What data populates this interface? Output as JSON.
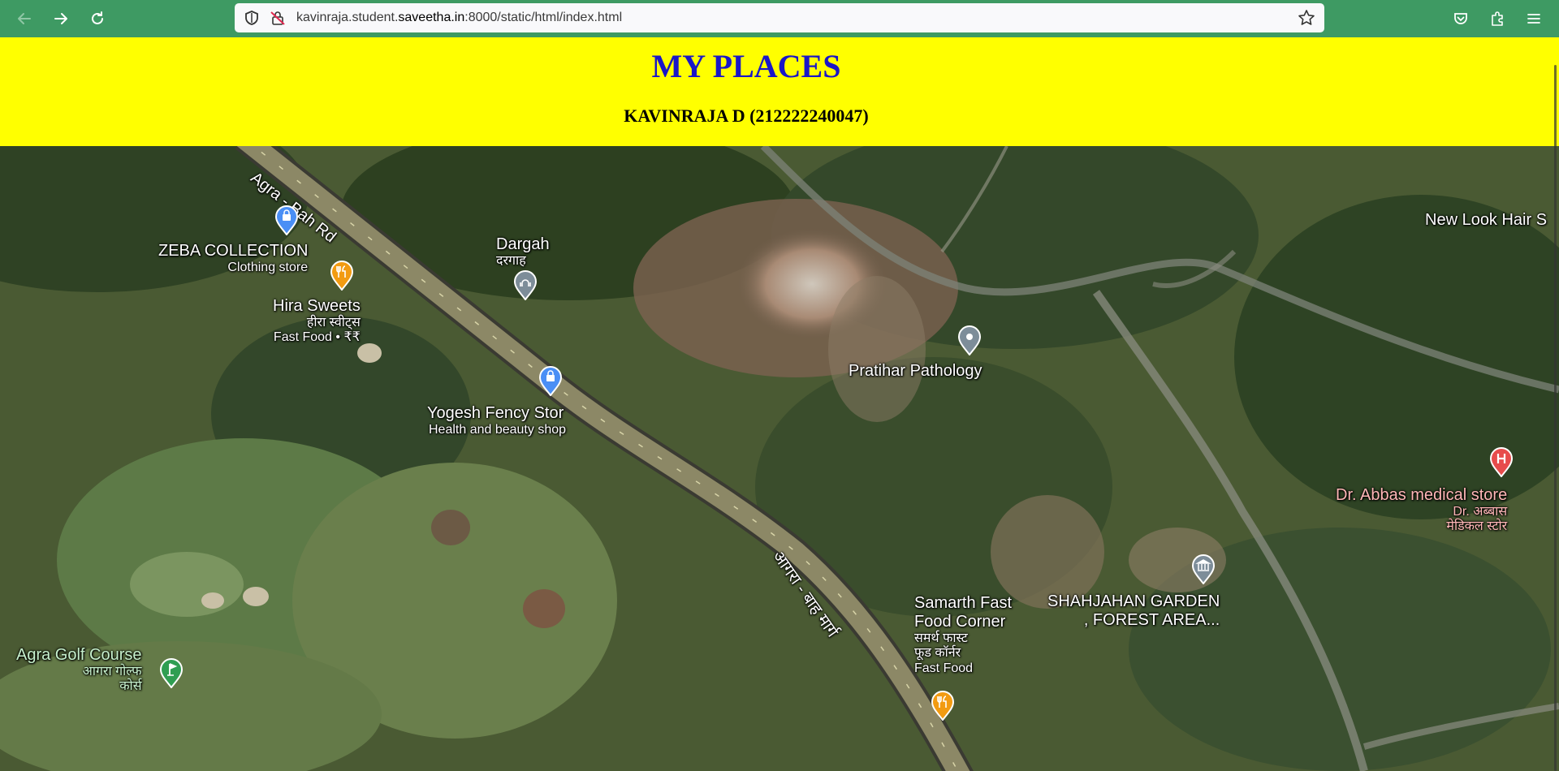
{
  "browser": {
    "url_prefix": "kavinraja.student.",
    "url_host": "saveetha.in",
    "url_suffix": ":8000/static/html/index.html",
    "icons": [
      "back-arrow-icon",
      "forward-arrow-icon",
      "reload-icon",
      "shield-icon",
      "insecure-lock-icon",
      "star-icon",
      "pocket-icon",
      "extensions-icon",
      "menu-icon"
    ]
  },
  "header": {
    "title": "MY PLACES",
    "subtitle": "KAVINRAJA D (212222240047)",
    "background": "#ffff00",
    "title_color": "#1a16c8"
  },
  "map": {
    "roads": {
      "main_road_en": "Agra - Bah Rd",
      "main_road_hi": "आगरा - बाह मार्ग"
    },
    "places": {
      "zeba": {
        "name": "ZEBA COLLECTION",
        "category": "Clothing store",
        "icon": "shopping-bag-icon"
      },
      "hira": {
        "name": "Hira Sweets",
        "name_hi": "हीरा स्वीट्स",
        "category": "Fast Food • ₹₹",
        "icon": "restaurant-icon"
      },
      "dargah": {
        "name": "Dargah",
        "name_hi": "दरगाह",
        "icon": "mosque-icon"
      },
      "yogesh": {
        "name": "Yogesh Fency Stor",
        "category": "Health and beauty shop",
        "icon": "shopping-bag-icon"
      },
      "pratihar": {
        "name": "Pratihar Pathology",
        "icon": "place-pin-icon"
      },
      "newlook": {
        "name": "New Look Hair S"
      },
      "abbas": {
        "name": "Dr. Abbas medical store",
        "name_hi_1": "Dr. अब्बास",
        "name_hi_2": "मेडिकल स्टोर",
        "icon": "hospital-icon"
      },
      "shahjahan": {
        "name_1": "SHAHJAHAN GARDEN",
        "name_2": ", FOREST AREA...",
        "icon": "museum-icon"
      },
      "samarth": {
        "name_1": "Samarth Fast",
        "name_2": "Food Corner",
        "name_hi_1": "समर्थ फास्ट",
        "name_hi_2": "फूड कॉर्नर",
        "category": "Fast Food",
        "icon": "restaurant-icon"
      },
      "golf": {
        "name": "Agra Golf Course",
        "name_hi_1": "आगरा गोल्फ",
        "name_hi_2": "कोर्स",
        "icon": "golf-icon"
      }
    }
  }
}
